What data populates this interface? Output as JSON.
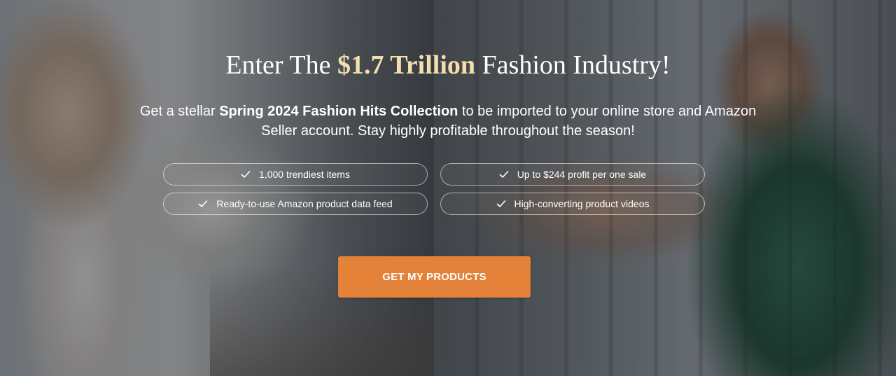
{
  "hero": {
    "headline": {
      "prefix": "Enter The ",
      "accent": "$1.7 Trillion",
      "suffix": " Fashion Industry!"
    },
    "subtext": {
      "part1": "Get a stellar ",
      "bold": "Spring 2024 Fashion Hits Collection",
      "part2": " to be imported to your online store and Amazon Seller account. Stay highly profitable throughout the season!"
    },
    "features": [
      {
        "label": "1,000 trendiest items",
        "icon": "check-icon"
      },
      {
        "label": "Up to $244 profit per one sale",
        "icon": "check-icon"
      },
      {
        "label": "Ready-to-use Amazon product data feed",
        "icon": "check-icon"
      },
      {
        "label": "High-converting product videos",
        "icon": "check-icon"
      }
    ],
    "cta_label": "GET MY PRODUCTS"
  },
  "colors": {
    "accent_text": "#f4dfae",
    "button": "#e5823a",
    "overlay": "rgba(25, 27, 30, 0.42)"
  }
}
